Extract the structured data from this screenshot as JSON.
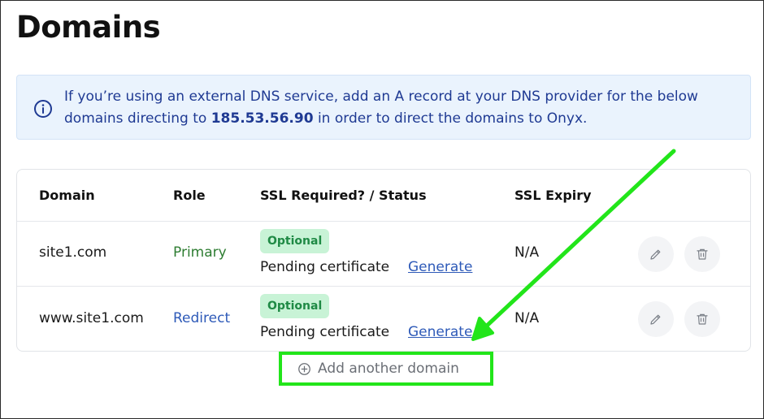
{
  "page": {
    "title": "Domains"
  },
  "info": {
    "text_before": "If you’re using an external DNS service, add an A record at your DNS provider for the below domains directing to ",
    "ip": "185.53.56.90",
    "text_after": " in order to direct the domains to Onyx.",
    "icon": "info-icon"
  },
  "table": {
    "headers": {
      "domain": "Domain",
      "role": "Role",
      "ssl": "SSL Required? / Status",
      "expiry": "SSL Expiry"
    },
    "rows": [
      {
        "domain": "site1.com",
        "role": "Primary",
        "badge": "Optional",
        "status": "Pending certificate",
        "action": "Generate",
        "expiry": "N/A"
      },
      {
        "domain": "www.site1.com",
        "role": "Redirect",
        "badge": "Optional",
        "status": "Pending certificate",
        "action": "Generate",
        "expiry": "N/A"
      }
    ]
  },
  "add_domain": {
    "label": "Add another domain",
    "icon": "plus-circle-icon"
  },
  "colors": {
    "info_bg": "#eaf3fd",
    "info_text": "#1f3a93",
    "primary_role": "#2e7d32",
    "redirect_role": "#2e5ab8",
    "badge_bg": "#c8f3d6",
    "badge_text": "#1f8a45",
    "annotation": "#22e51a"
  }
}
